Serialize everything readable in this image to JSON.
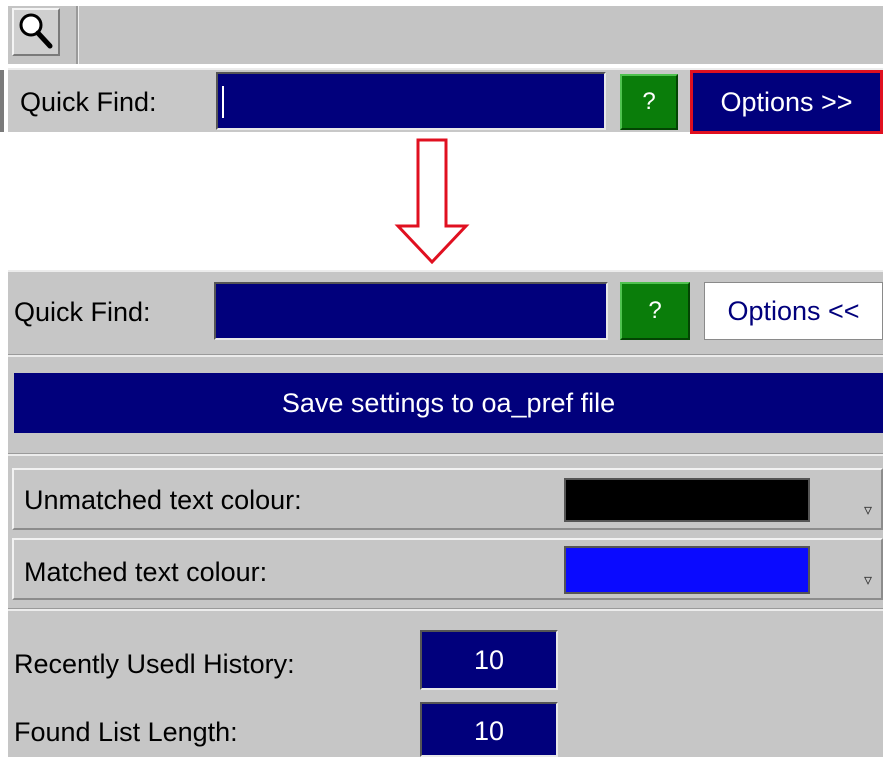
{
  "toolbar": {
    "search_icon": "magnifier-icon"
  },
  "collapsed": {
    "label": "Quick Find:",
    "search_value": "",
    "help_label": "?",
    "options_label": "Options >>"
  },
  "expanded": {
    "label": "Quick Find:",
    "search_value": "",
    "help_label": "?",
    "options_label": "Options <<",
    "save_label": "Save settings to oa_pref file",
    "unmatched_label": "Unmatched text colour:",
    "unmatched_colour": "#000000",
    "matched_label": "Matched text  colour:",
    "matched_colour": "#0a0aff",
    "history_label": "Recently Usedl History:",
    "history_value": "10",
    "found_label": "Found List Length:",
    "found_value": "10"
  },
  "colors": {
    "field_blue": "#01007c",
    "help_green": "#0a7d0a",
    "highlight_red": "#e01020",
    "panel_grey": "#c6c6c6"
  }
}
